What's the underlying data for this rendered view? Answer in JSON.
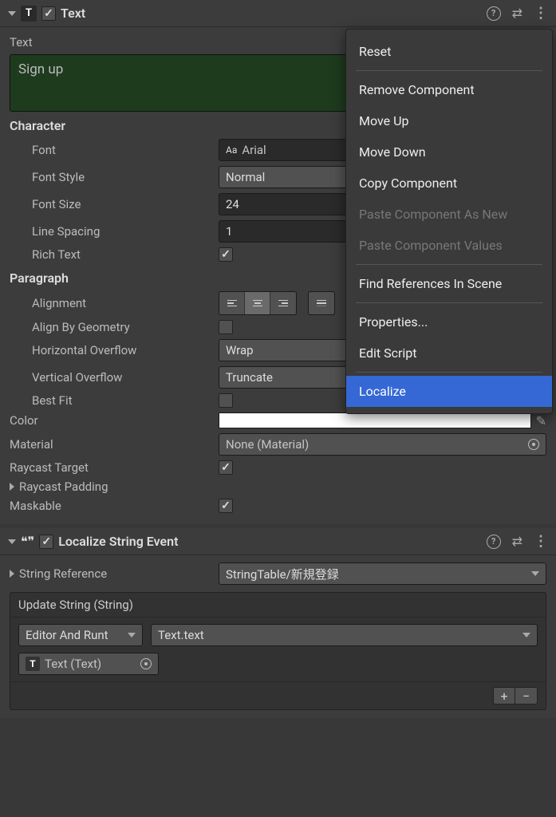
{
  "text_component": {
    "title": "Text",
    "icon_letter": "T",
    "text_label": "Text",
    "text_value": "Sign up",
    "character": {
      "title": "Character",
      "font_label": "Font",
      "font_value": "Arial",
      "font_style_label": "Font Style",
      "font_style_value": "Normal",
      "font_size_label": "Font Size",
      "font_size_value": "24",
      "line_spacing_label": "Line Spacing",
      "line_spacing_value": "1",
      "rich_text_label": "Rich Text"
    },
    "paragraph": {
      "title": "Paragraph",
      "alignment_label": "Alignment",
      "align_by_geometry_label": "Align By Geometry",
      "h_overflow_label": "Horizontal Overflow",
      "h_overflow_value": "Wrap",
      "v_overflow_label": "Vertical Overflow",
      "v_overflow_value": "Truncate",
      "best_fit_label": "Best Fit"
    },
    "color_label": "Color",
    "color_value": "#ffffff",
    "material_label": "Material",
    "material_value": "None (Material)",
    "raycast_target_label": "Raycast Target",
    "raycast_padding_label": "Raycast Padding",
    "maskable_label": "Maskable"
  },
  "localize_component": {
    "title": "Localize String Event",
    "string_ref_label": "String Reference",
    "string_ref_value": "StringTable/新規登録",
    "update_string_label": "Update String (String)",
    "call_mode_value": "Editor And Runt",
    "target_method_value": "Text.text",
    "target_object_value": "Text (Text)",
    "target_object_icon": "T"
  },
  "context_menu": {
    "reset": "Reset",
    "remove_component": "Remove Component",
    "move_up": "Move Up",
    "move_down": "Move Down",
    "copy_component": "Copy Component",
    "paste_as_new": "Paste Component As New",
    "paste_values": "Paste Component Values",
    "find_refs": "Find References In Scene",
    "properties": "Properties...",
    "edit_script": "Edit Script",
    "localize": "Localize"
  }
}
